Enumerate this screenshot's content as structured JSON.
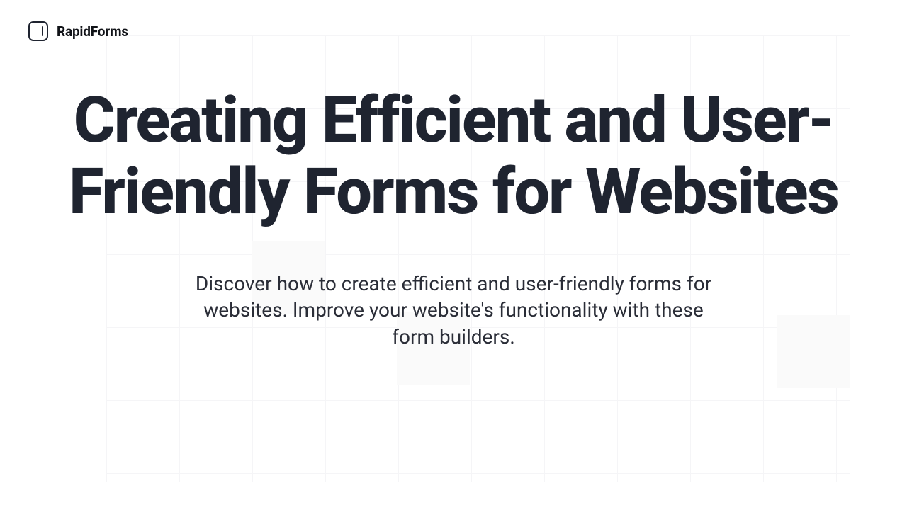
{
  "brand": "RapidForms",
  "hero": {
    "title": "Creating Efficient and User-Friendly Forms for Websites",
    "subtitle": "Discover how to create efficient and user-friendly forms for websites. Improve your website's functionality with these form builders."
  }
}
